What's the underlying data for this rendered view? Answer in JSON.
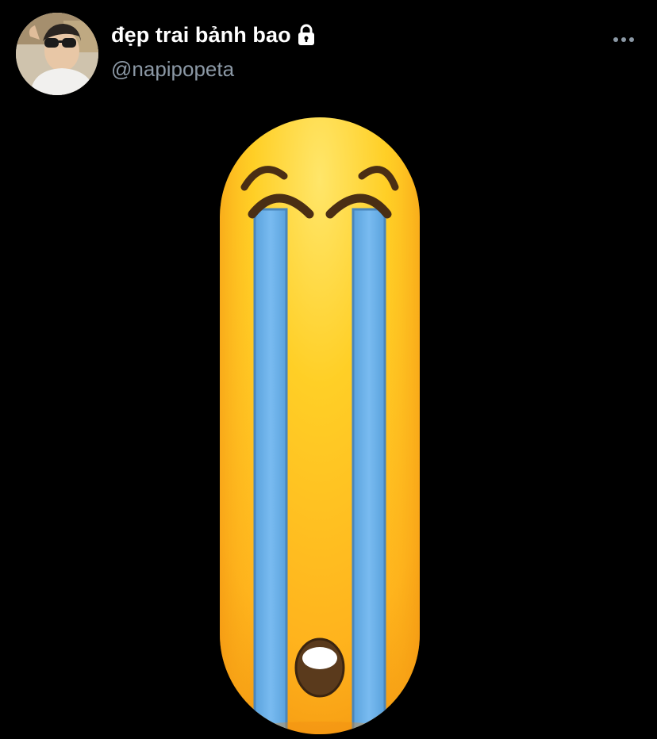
{
  "tweet": {
    "author": {
      "display_name": "đẹp trai bảnh bao",
      "handle": "@napipopeta",
      "avatar_icon": "avatar-photo",
      "protected_icon": "lock-icon"
    },
    "more_icon": "more-options-icon",
    "media": {
      "description_icon": "stretched-loudly-crying-face-emoji"
    }
  },
  "colors": {
    "background": "#000000",
    "name": "#ffffff",
    "handle": "#8b98a5",
    "emoji_yellow": "#ffcc22",
    "tear_blue": "#6fb3ea"
  }
}
